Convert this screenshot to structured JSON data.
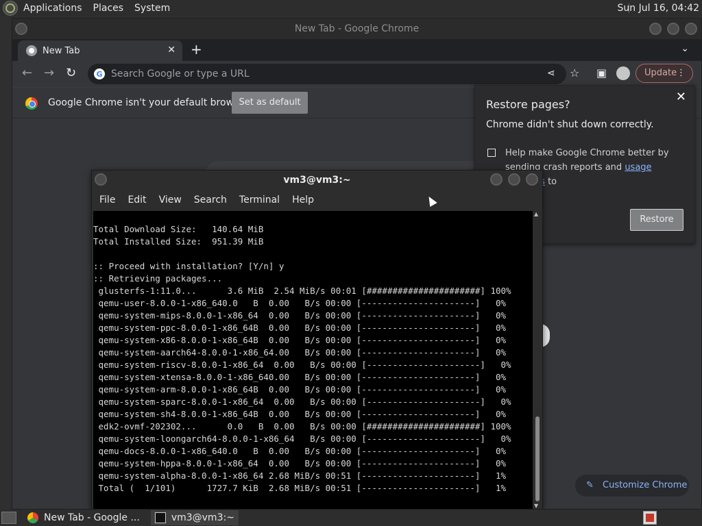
{
  "top_panel": {
    "menus": [
      "Applications",
      "Places",
      "System"
    ],
    "clock": "Sun Jul 16, 04:42"
  },
  "chrome": {
    "window_title": "New Tab - Google Chrome",
    "tab_title": "New Tab",
    "omnibox_placeholder": "Search Google or type a URL",
    "update_label": "Update",
    "infobar": {
      "message": "Google Chrome isn't your default browser",
      "button": "Set as default"
    },
    "restore": {
      "title": "Restore pages?",
      "subtitle": "Chrome didn't shut down correctly.",
      "help_pre": "Help make Google Chrome better by sending crash reports and ",
      "help_link": "usage statistics",
      "help_post": " to",
      "button": "Restore"
    },
    "customize_label": "Customize Chrome"
  },
  "terminal": {
    "title": "vm3@vm3:~",
    "menus": [
      "File",
      "Edit",
      "View",
      "Search",
      "Terminal",
      "Help"
    ],
    "lines": [
      "Total Download Size:   140.64 MiB",
      "Total Installed Size:  951.39 MiB",
      "",
      ":: Proceed with installation? [Y/n] y",
      ":: Retrieving packages...",
      " glusterfs-1:11.0...      3.6 MiB  2.54 MiB/s 00:01 [######################] 100%",
      " qemu-user-8.0.0-1-x86_640.0   B  0.00   B/s 00:00 [----------------------]   0%",
      " qemu-system-mips-8.0.0-1-x86_64  0.00   B/s 00:00 [----------------------]   0%",
      " qemu-system-ppc-8.0.0-1-x86_64B  0.00   B/s 00:00 [----------------------]   0%",
      " qemu-system-x86-8.0.0-1-x86_64B  0.00   B/s 00:00 [----------------------]   0%",
      " qemu-system-aarch64-8.0.0-1-x86_64.00   B/s 00:00 [----------------------]   0%",
      " qemu-system-riscv-8.0.0-1-x86_64  0.00   B/s 00:00 [----------------------]   0%",
      " qemu-system-xtensa-8.0.0-1-x86_640.00   B/s 00:00 [----------------------]   0%",
      " qemu-system-arm-8.0.0-1-x86_64B  0.00   B/s 00:00 [----------------------]   0%",
      " qemu-system-sparc-8.0.0-1-x86_64  0.00   B/s 00:00 [----------------------]   0%",
      " qemu-system-sh4-8.0.0-1-x86_64B  0.00   B/s 00:00 [----------------------]   0%",
      " edk2-ovmf-202302...      0.0   B  0.00   B/s 00:00 [######################] 100%",
      " qemu-system-loongarch64-8.0.0-1-x86_64   B/s 00:00 [----------------------]   0%",
      " qemu-docs-8.0.0-1-x86_640.0   B  0.00   B/s 00:00 [----------------------]   0%",
      " qemu-system-hppa-8.0.0-1-x86_64  0.00   B/s 00:00 [----------------------]   0%",
      " qemu-system-alpha-8.0.0-1-x86_64 2.68 MiB/s 00:51 [----------------------]   1%",
      " Total (  1/101)      1727.7 KiB  2.68 MiB/s 00:51 [----------------------]   1%"
    ]
  },
  "taskbar": {
    "items": [
      "New Tab - Google ...",
      "vm3@vm3:~"
    ]
  }
}
